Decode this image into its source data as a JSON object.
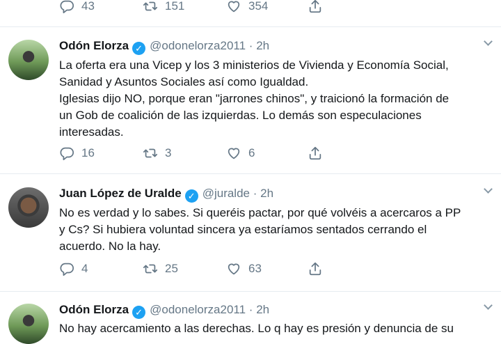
{
  "top_actions": {
    "replies": "43",
    "retweets": "151",
    "likes": "354"
  },
  "tweets": [
    {
      "name": "Odón Elorza",
      "handle": "@odonelorza2011",
      "separator": "·",
      "time": "2h",
      "text": "La oferta era una Vicep y los 3 ministerios de Vivienda y Economía Social,\nSanidad y Asuntos Sociales así como Igualdad.\nIglesias dijo NO, porque eran \"jarrones chinos\", y traicionó la formación de\nun Gob de coalición de las izquierdas. Lo demás son especulaciones\ninteresadas.",
      "replies": "16",
      "retweets": "3",
      "likes": "6"
    },
    {
      "name": "Juan López de Uralde",
      "handle": "@juralde",
      "separator": "·",
      "time": "2h",
      "text": "No es verdad y lo sabes. Si queréis pactar, por qué volvéis a acercaros a PP\ny Cs? Si hubiera voluntad sincera ya estaríamos sentados cerrando el\nacuerdo. No la hay.",
      "replies": "4",
      "retweets": "25",
      "likes": "63"
    },
    {
      "name": "Odón Elorza",
      "handle": "@odonelorza2011",
      "separator": "·",
      "time": "2h",
      "text": "No hay acercamiento a las derechas. Lo q hay es presión y denuncia de su"
    }
  ],
  "icons": {
    "verified": "verified-badge-icon",
    "reply": "reply-icon",
    "retweet": "retweet-icon",
    "like": "heart-icon",
    "share": "share-icon",
    "more": "chevron-down-icon"
  },
  "colors": {
    "text": "#14171a",
    "muted": "#657786",
    "verified": "#1da1f2",
    "divider": "#e6ecf0"
  }
}
